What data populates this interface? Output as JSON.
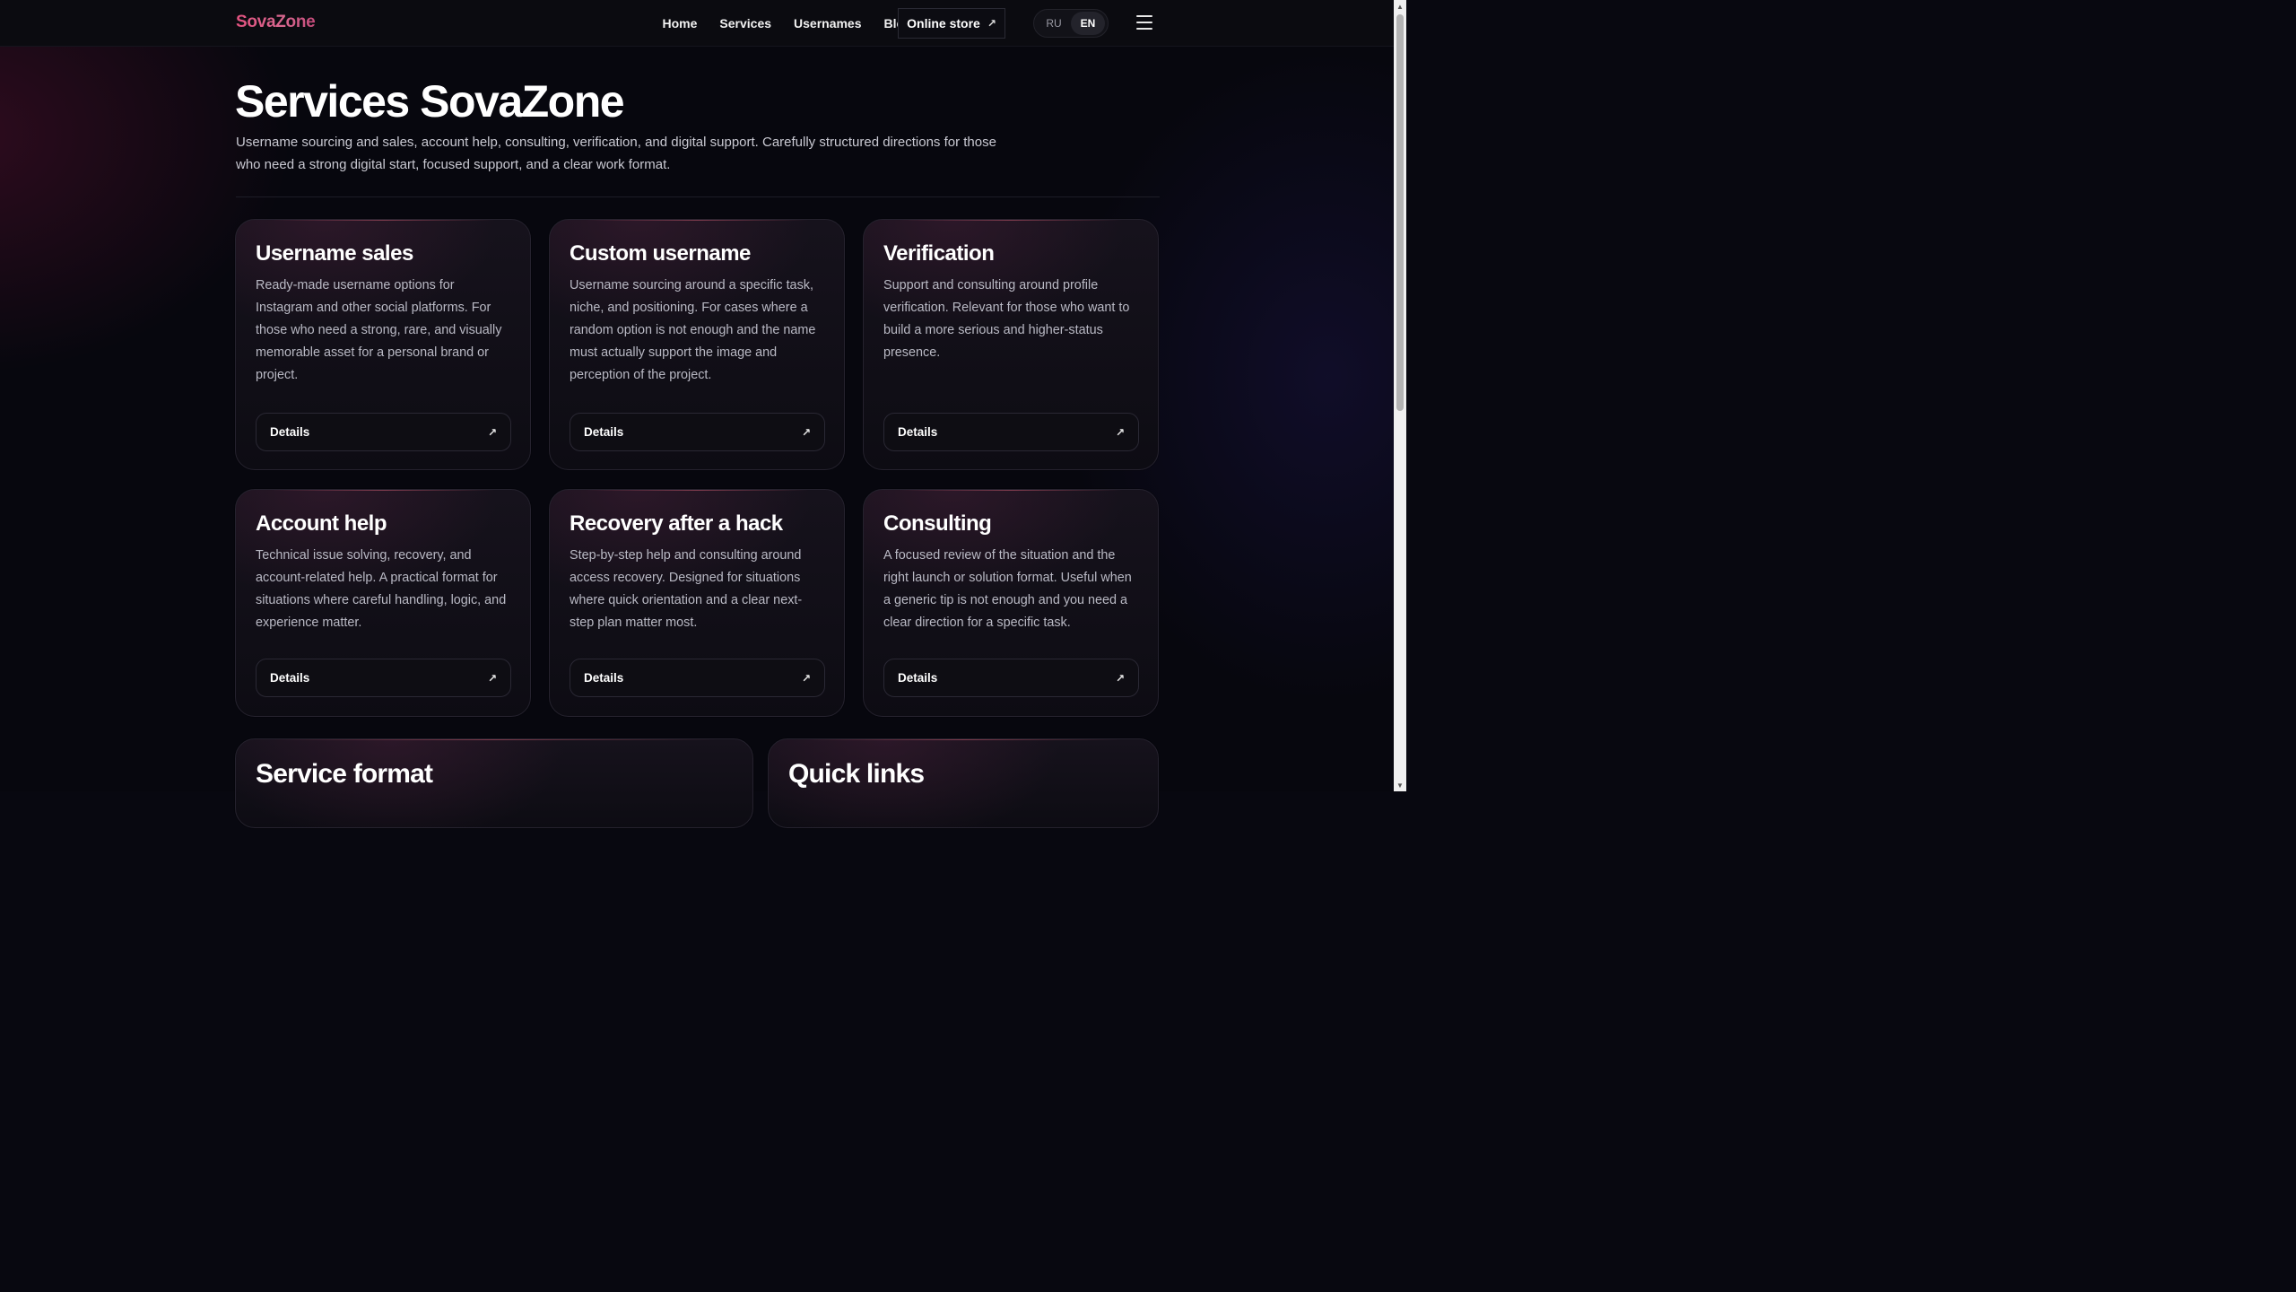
{
  "header": {
    "logo": "SovaZone",
    "nav": [
      "Home",
      "Services",
      "Usernames",
      "Blog"
    ],
    "store_label": "Online store",
    "store_arrow": "↗",
    "lang": {
      "ru": "RU",
      "en": "EN",
      "active": "EN"
    }
  },
  "hero": {
    "title": "Services SovaZone",
    "description": "Username sourcing and sales, account help, consulting, verification, and digital support. Carefully structured directions for those who need a strong digital start, focused support, and a clear work format."
  },
  "cards": [
    {
      "title": "Username sales",
      "text": "Ready-made username options for Instagram and other social platforms. For those who need a strong, rare, and visually memorable asset for a personal brand or project.",
      "button": "Details"
    },
    {
      "title": "Custom username",
      "text": "Username sourcing around a specific task, niche, and positioning. For cases where a random option is not enough and the name must actually support the image and perception of the project.",
      "button": "Details"
    },
    {
      "title": "Verification",
      "text": "Support and consulting around profile verification. Relevant for those who want to build a more serious and higher-status presence.",
      "button": "Details"
    },
    {
      "title": "Account help",
      "text": "Technical issue solving, recovery, and account-related help. A practical format for situations where careful handling, logic, and experience matter.",
      "button": "Details"
    },
    {
      "title": "Recovery after a hack",
      "text": "Step-by-step help and consulting around access recovery. Designed for situations where quick orientation and a clear next-step plan matter most.",
      "button": "Details"
    },
    {
      "title": "Consulting",
      "text": "A focused review of the situation and the right launch or solution format. Useful when a generic tip is not enough and you need a clear direction for a specific task.",
      "button": "Details"
    }
  ],
  "bottom": {
    "format_title": "Service format",
    "links_title": "Quick links"
  },
  "icons": {
    "details_arrow": "arrow-up-right-icon",
    "menu": "hamburger-menu-icon"
  },
  "colors": {
    "accent": "#e2527f",
    "background": "#07070e"
  }
}
